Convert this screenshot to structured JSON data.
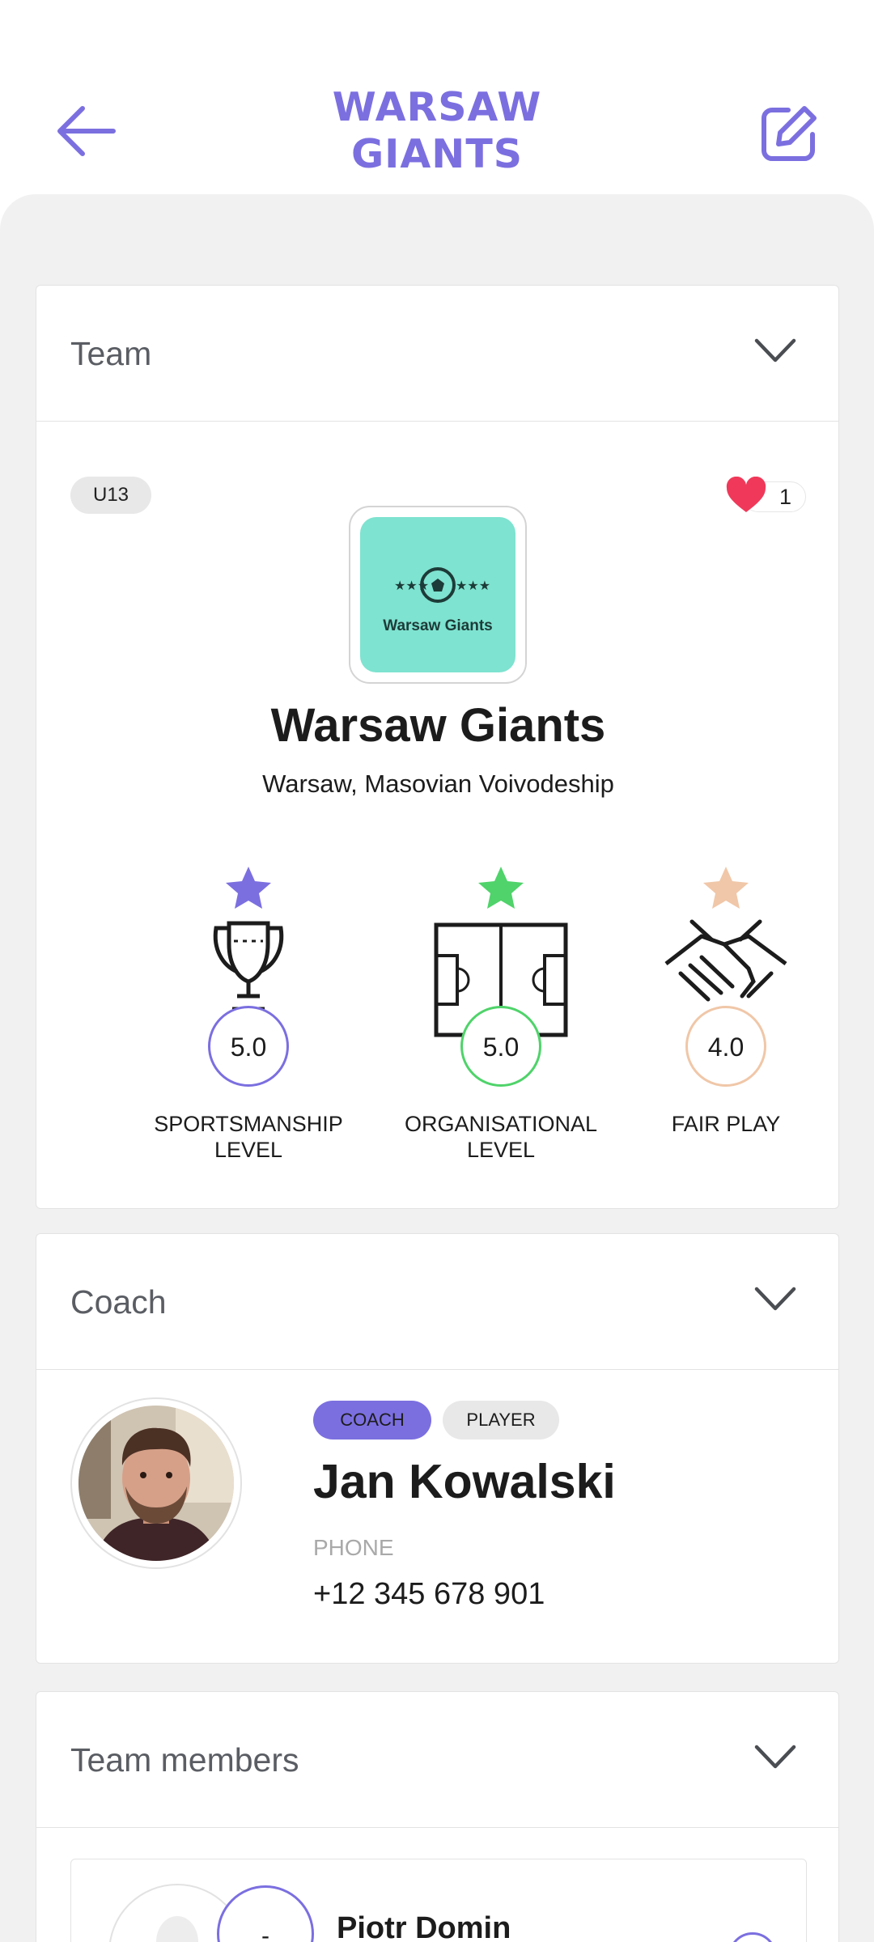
{
  "header": {
    "title_line1": "WARSAW",
    "title_line2": "GIANTS",
    "back_icon": "arrow-left-icon",
    "edit_icon": "edit-icon"
  },
  "colors": {
    "accent": "#7b6fe0",
    "background": "#f1f1f1",
    "logo_bg": "#7ee3d0",
    "star_purple": "#7b6fe0",
    "star_green": "#4fd36a",
    "star_peach": "#f0c7a8",
    "heart": "#f0395a"
  },
  "team_section": {
    "heading": "Team",
    "age_group": "U13",
    "likes": "1",
    "logo_text": "Warsaw Giants",
    "name": "Warsaw Giants",
    "location": "Warsaw, Masovian Voivodeship",
    "stats": [
      {
        "score": "5.0",
        "label_line1": "SPORTSMANSHIP",
        "label_line2": "LEVEL",
        "icon": "trophy-icon"
      },
      {
        "score": "5.0",
        "label_line1": "ORGANISATIONAL",
        "label_line2": "LEVEL",
        "icon": "pitch-icon"
      },
      {
        "score": "4.0",
        "label_line1": "FAIR PLAY",
        "label_line2": "",
        "icon": "handshake-icon"
      }
    ]
  },
  "coach_section": {
    "heading": "Coach",
    "roles": [
      "COACH",
      "PLAYER"
    ],
    "name": "Jan Kowalski",
    "phone_label": "PHONE",
    "phone": "+12 345 678 901"
  },
  "members_section": {
    "heading": "Team members",
    "members": [
      {
        "number": "-",
        "name": "Piotr Domin"
      }
    ]
  }
}
